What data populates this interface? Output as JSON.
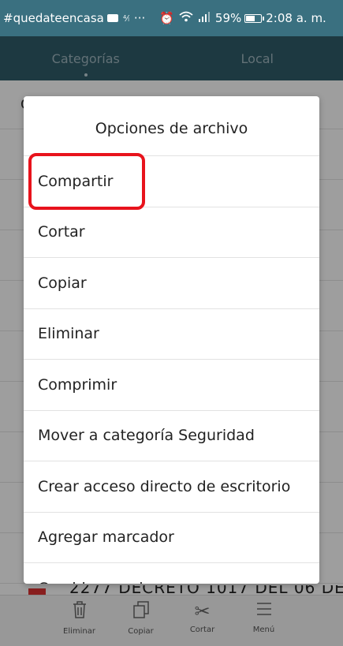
{
  "status_bar": {
    "hashtag": "#quedateencasa",
    "dots": "···",
    "battery_pct": "59%",
    "time": "2:08 a. m."
  },
  "tabs": [
    {
      "label": "Categorías",
      "active": true
    },
    {
      "label": "Local",
      "active": false
    }
  ],
  "background": {
    "file_name": "2277 DECRETO 1017 DEL 06 DE",
    "first_row_initial": "C"
  },
  "dialog": {
    "title": "Opciones de archivo",
    "options": [
      {
        "label": "Compartir",
        "highlighted": true
      },
      {
        "label": "Cortar"
      },
      {
        "label": "Copiar"
      },
      {
        "label": "Eliminar"
      },
      {
        "label": "Comprimir"
      },
      {
        "label": "Mover a categoría Seguridad"
      },
      {
        "label": "Crear acceso directo de escritorio"
      },
      {
        "label": "Agregar marcador"
      },
      {
        "label": "Cambiar nombre"
      }
    ]
  },
  "toolbar": {
    "items": [
      {
        "label": "Eliminar",
        "icon": "trash-icon"
      },
      {
        "label": "Copiar",
        "icon": "copy-icon"
      },
      {
        "label": "Cortar",
        "icon": "scissors-icon"
      },
      {
        "label": "Menú",
        "icon": "menu-icon"
      }
    ]
  },
  "colors": {
    "status_bar": "#3a7080",
    "tab_bar": "#2f5c6a",
    "highlight": "#e8131c"
  }
}
